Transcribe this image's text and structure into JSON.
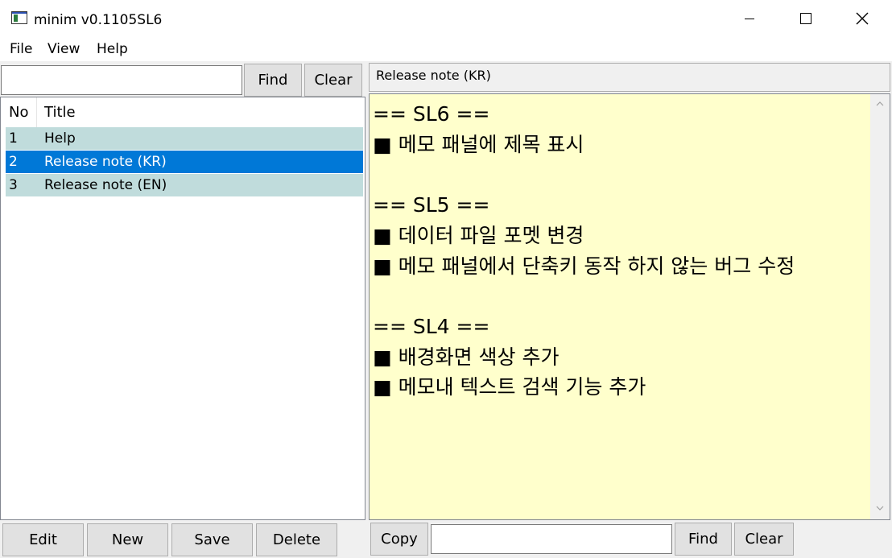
{
  "window": {
    "title": "minim v0.1105SL6",
    "minimize_glyph": "—",
    "maximize_glyph": "☐",
    "close_glyph": "✕"
  },
  "menu": {
    "items": [
      "File",
      "View",
      "Help"
    ]
  },
  "left": {
    "search": {
      "value": "",
      "placeholder": ""
    },
    "find_label": "Find",
    "clear_label": "Clear",
    "columns": [
      "No",
      "Title"
    ],
    "rows": [
      {
        "no": "1",
        "title": "Help",
        "selected": false
      },
      {
        "no": "2",
        "title": "Release note (KR)",
        "selected": true
      },
      {
        "no": "3",
        "title": "Release note (EN)",
        "selected": false
      }
    ],
    "buttons": {
      "edit": "Edit",
      "new": "New",
      "save": "Save",
      "delete": "Delete"
    }
  },
  "right": {
    "memo_title": "Release note (KR)",
    "memo_text": "== SL6 ==\n■ 메모 패널에 제목 표시\n\n== SL5 ==\n■ 데이터 파일 포멧 변경\n■ 메모 패널에서 단축키 동작 하지 않는 버그 수정\n\n== SL4 ==\n■ 배경화면 색상 추가\n■ 메모내 텍스트 검색 기능 추가",
    "memo_bg_color": "#ffffcc",
    "copy_label": "Copy",
    "search": {
      "value": "",
      "placeholder": ""
    },
    "find_label": "Find",
    "clear_label": "Clear"
  },
  "colors": {
    "selection": "#0078d7",
    "row_bg": "#c0dcdc"
  }
}
